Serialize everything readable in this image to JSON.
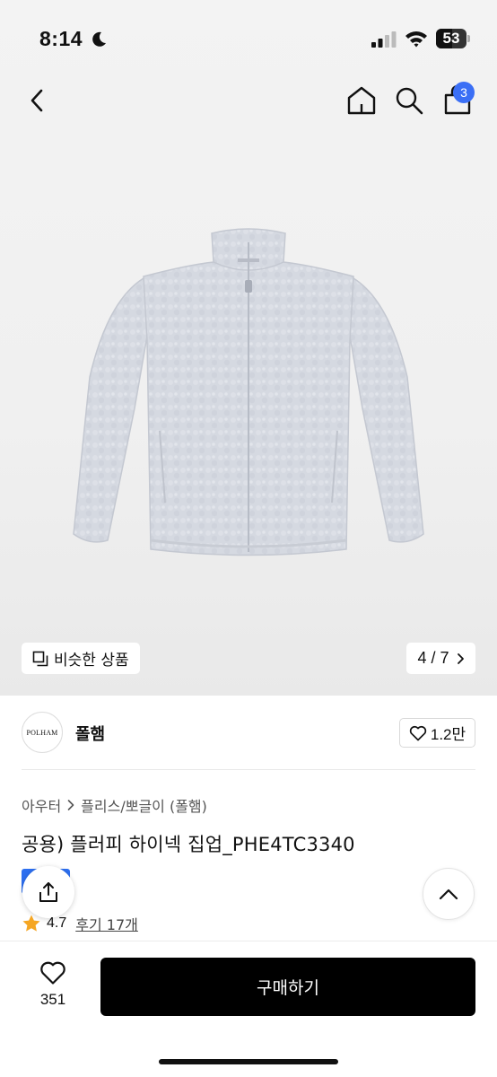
{
  "status_bar": {
    "time": "8:14",
    "battery_level": "53",
    "icons": [
      "moon-icon",
      "cellular-signal-icon",
      "wifi-icon",
      "battery-icon"
    ]
  },
  "nav": {
    "icons": [
      "back-chevron-icon",
      "home-icon",
      "search-icon",
      "shopping-bag-icon"
    ],
    "cart_count": "3"
  },
  "gallery": {
    "similar_label": "비슷한 상품",
    "counter": "4 / 7",
    "current": 4,
    "total": 7
  },
  "brand": {
    "logo_text": "POLHAM",
    "name": "폴햄",
    "like_count": "1.2만"
  },
  "product": {
    "breadcrumb": [
      "아우터",
      "플리스/뽀글이 (폴햄)"
    ],
    "title": "공용) 플러피 하이넥 집업_PHE4TC3340",
    "rating": "4.7",
    "review_label": "후기 17개"
  },
  "bottom": {
    "wish_count": "351",
    "buy_label": "구매하기"
  },
  "colors": {
    "accent": "#3b6ff5",
    "star": "#f5a623",
    "buy_button": "#000000"
  }
}
